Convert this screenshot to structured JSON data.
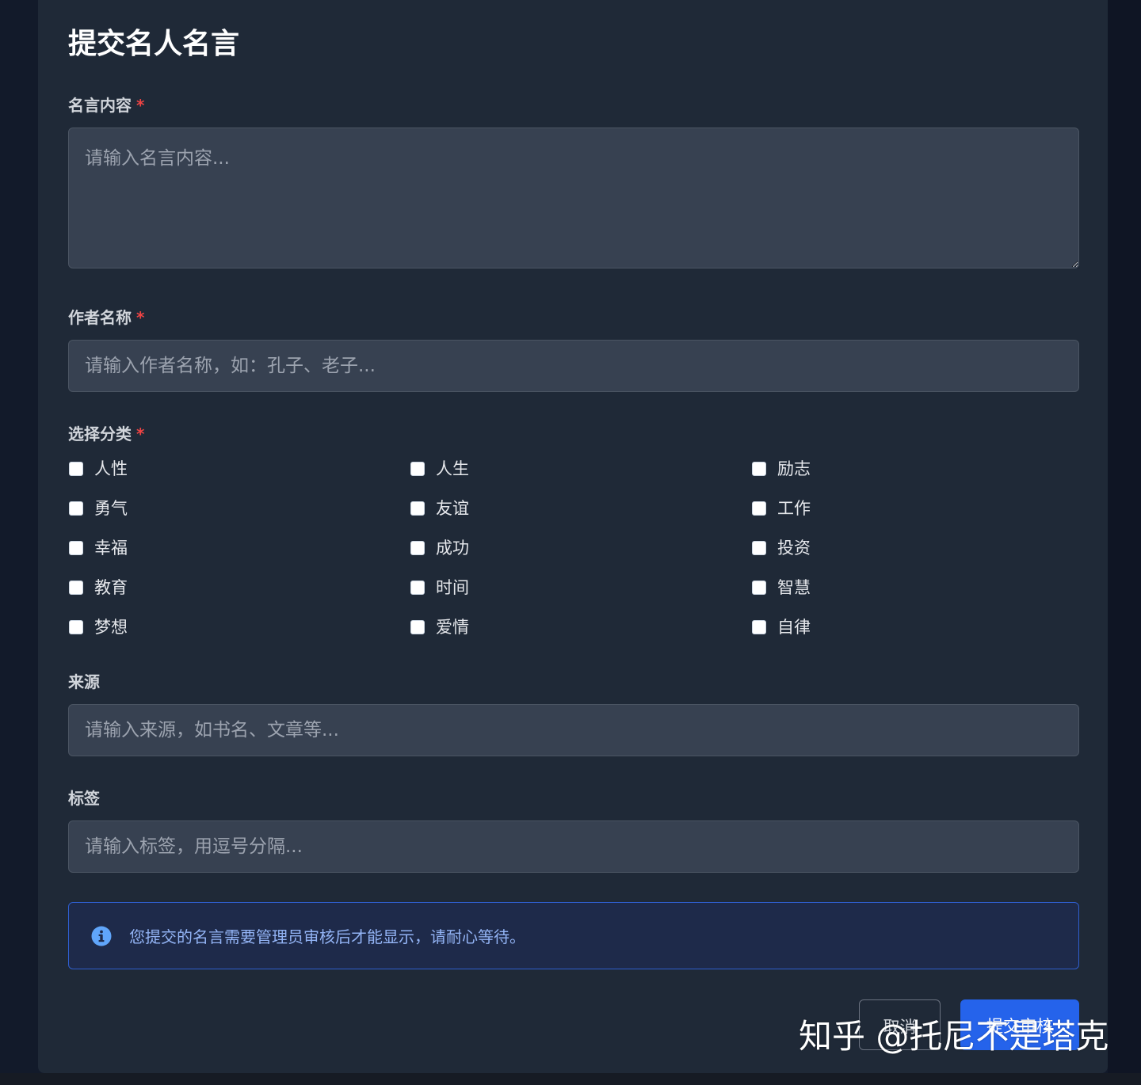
{
  "form": {
    "title": "提交名人名言",
    "required_mark": "*",
    "quote": {
      "label": "名言内容",
      "placeholder": "请输入名言内容..."
    },
    "author": {
      "label": "作者名称",
      "placeholder": "请输入作者名称，如：孔子、老子..."
    },
    "category": {
      "label": "选择分类",
      "options": [
        "人性",
        "人生",
        "励志",
        "勇气",
        "友谊",
        "工作",
        "幸福",
        "成功",
        "投资",
        "教育",
        "时间",
        "智慧",
        "梦想",
        "爱情",
        "自律"
      ]
    },
    "source": {
      "label": "来源",
      "placeholder": "请输入来源，如书名、文章等..."
    },
    "tags": {
      "label": "标签",
      "placeholder": "请输入标签，用逗号分隔..."
    },
    "notice": {
      "icon": "info-icon",
      "text": "您提交的名言需要管理员审核后才能显示，请耐心等待。"
    },
    "actions": {
      "cancel_label": "取消",
      "submit_label": "提交审核"
    }
  },
  "watermark": "知乎 @托尼不是塔克",
  "colors": {
    "page_background": "#121a2a",
    "card_background": "#1f2937",
    "input_background": "#374151",
    "required": "#ef4444",
    "notice_border": "#2f5fd0",
    "notice_text": "#93b4f5",
    "primary_button": "#2563eb"
  }
}
